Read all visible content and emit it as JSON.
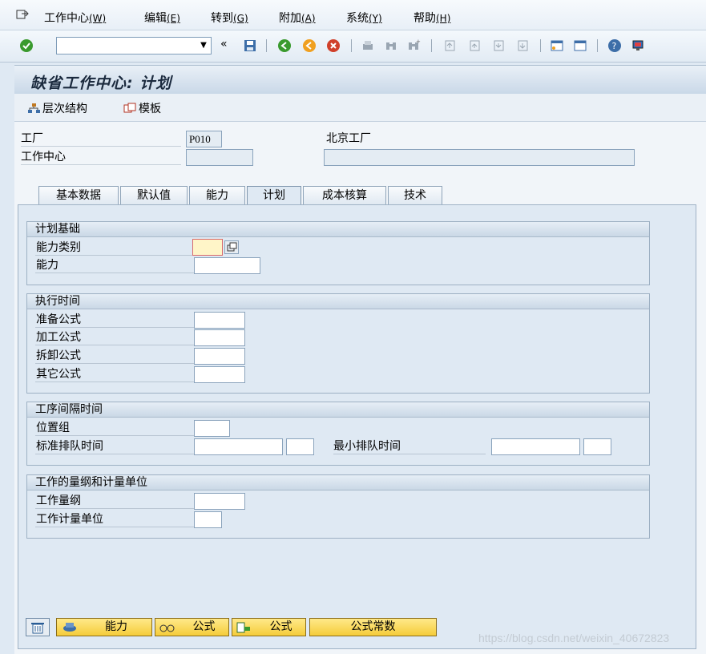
{
  "menu": [
    {
      "label": "工作中心",
      "hot": "(W)"
    },
    {
      "label": "编辑",
      "hot": "(E)"
    },
    {
      "label": "转到",
      "hot": "(G)"
    },
    {
      "label": "附加",
      "hot": "(A)"
    },
    {
      "label": "系统",
      "hot": "(Y)"
    },
    {
      "label": "帮助",
      "hot": "(H)"
    }
  ],
  "toolbar": {
    "command_value": "",
    "dd": "▼",
    "back": "«"
  },
  "title": "缺省工作中心: 计划",
  "app_toolbar": {
    "hierarchy": "层次结构",
    "template": "模板"
  },
  "header": {
    "plant_label": "工厂",
    "plant_value": "P010",
    "plant_name": "北京工厂",
    "wc_label": "工作中心",
    "wc_value": "",
    "wc_desc": ""
  },
  "tabs": [
    "基本数据",
    "默认值",
    "能力",
    "计划",
    "成本核算",
    "技术"
  ],
  "active_tab": "计划",
  "groups": {
    "planning_basis": {
      "title": "计划基础",
      "cap_category": "能力类别",
      "cap_category_value": "",
      "capacity": "能力"
    },
    "exec_time": {
      "title": "执行时间",
      "setup": "准备公式",
      "processing": "加工公式",
      "teardown": "拆卸公式",
      "other": "其它公式"
    },
    "interop_time": {
      "title": "工序间隔时间",
      "location_group": "位置组",
      "std_queue": "标准排队时间",
      "min_queue": "最小排队时间"
    },
    "dimension": {
      "title": "工作的量纲和计量单位",
      "work_dim": "工作量纲",
      "work_unit": "工作计量单位"
    }
  },
  "bottom_buttons": {
    "capacity": "能力",
    "formula1": "公式",
    "formula2": "公式",
    "constants": "公式常数"
  },
  "watermark": "https://blog.csdn.net/weixin_40672823",
  "colors": {
    "accent": "#f5cc3a",
    "background": "#dfe9f3",
    "title": "#1b2a3e"
  }
}
